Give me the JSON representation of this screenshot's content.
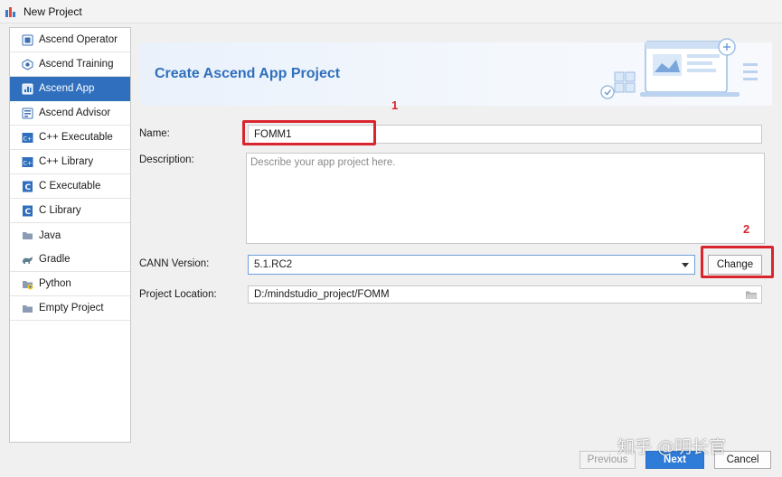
{
  "window": {
    "title": "New Project"
  },
  "sidebar": {
    "items": [
      {
        "label": "Ascend Operator",
        "icon": "ascend-operator-icon"
      },
      {
        "label": "Ascend Training",
        "icon": "ascend-training-icon"
      },
      {
        "label": "Ascend App",
        "icon": "ascend-app-icon",
        "selected": true
      },
      {
        "label": "Ascend Advisor",
        "icon": "ascend-advisor-icon"
      },
      {
        "label": "C++ Executable",
        "icon": "cpp-icon"
      },
      {
        "label": "C++ Library",
        "icon": "cpp-icon"
      },
      {
        "label": "C Executable",
        "icon": "c-icon"
      },
      {
        "label": "C Library",
        "icon": "c-icon"
      },
      {
        "label": "Java",
        "icon": "folder-icon"
      },
      {
        "label": "Gradle",
        "icon": "gradle-icon"
      },
      {
        "label": "Python",
        "icon": "python-icon"
      },
      {
        "label": "Empty Project",
        "icon": "folder-icon"
      }
    ]
  },
  "banner": {
    "title": "Create Ascend App Project"
  },
  "form": {
    "name_label": "Name:",
    "name_value": "FOMM1",
    "description_label": "Description:",
    "description_placeholder": "Describe your app project here.",
    "cann_label": "CANN Version:",
    "cann_value": "5.1.RC2",
    "change_button": "Change",
    "location_label": "Project Location:",
    "location_value": "D:/mindstudio_project/FOMM"
  },
  "annotations": {
    "marker1": "1",
    "marker2": "2"
  },
  "footer": {
    "previous_button": "Previous",
    "next_button": "Next",
    "cancel_button": "Cancel"
  },
  "watermark": "知乎 @明长官",
  "colors": {
    "accent": "#2f6fbd",
    "annotation": "#d9252e",
    "primary_button": "#2f7bd8"
  }
}
